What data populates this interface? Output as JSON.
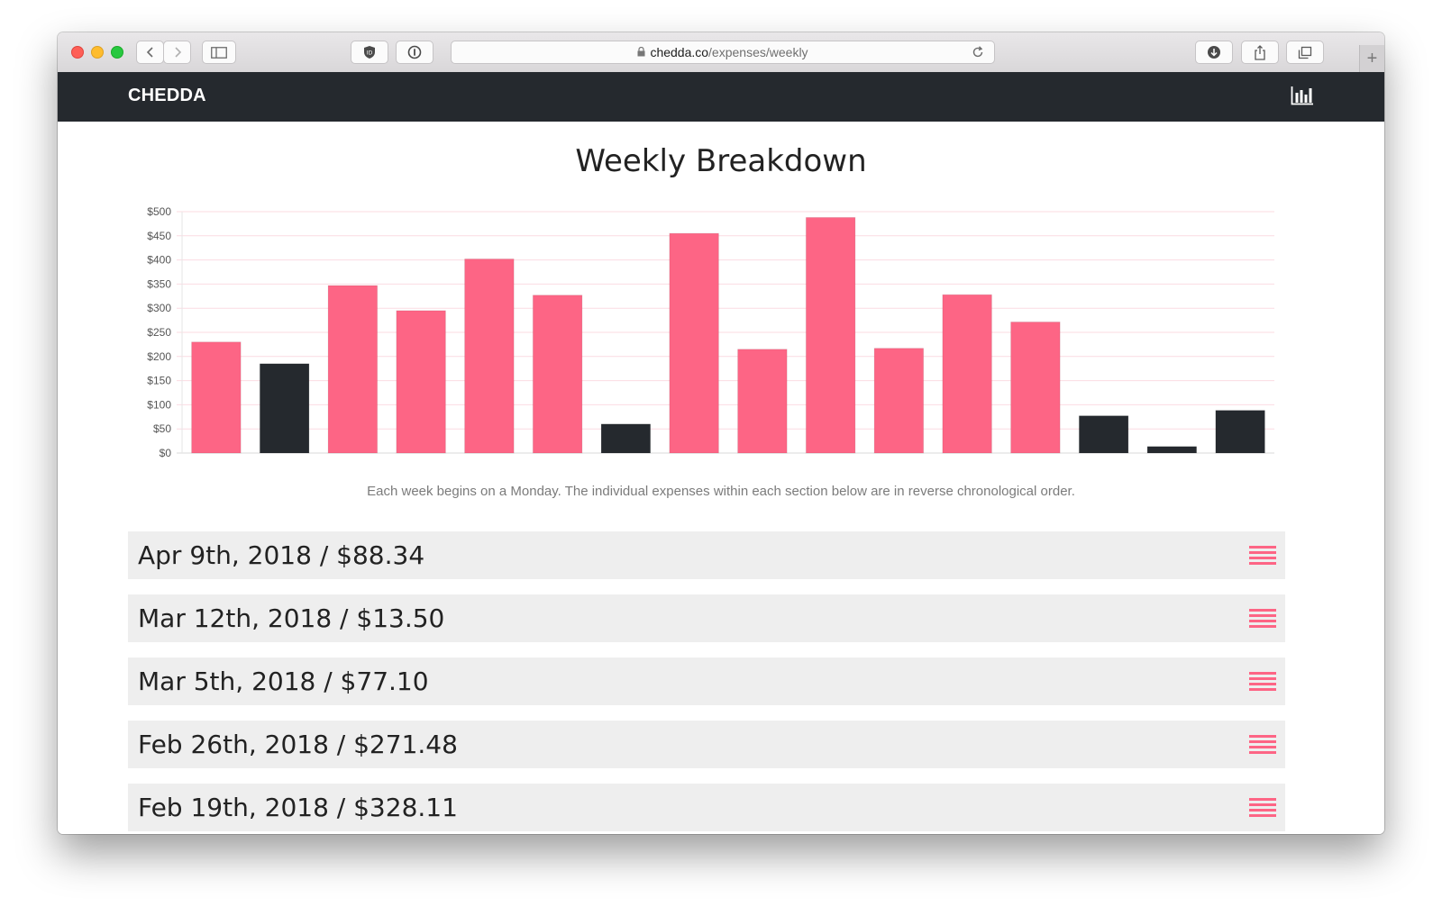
{
  "browser": {
    "url_host": "chedda.co",
    "url_path": "/expenses/weekly"
  },
  "navbar": {
    "brand": "CHEDDA",
    "stats_icon": "bar-chart-icon"
  },
  "page": {
    "title": "Weekly Breakdown",
    "caption": "Each week begins on a Monday. The individual expenses within each section below are in reverse chronological order."
  },
  "colors": {
    "pink": "#fd6585",
    "dark": "#25292e",
    "grid": "#fbdbe2",
    "row_bg": "#eeeeee"
  },
  "chart_data": {
    "type": "bar",
    "title": "",
    "xlabel": "",
    "ylabel": "",
    "ylim": [
      0,
      500
    ],
    "y_ticks": [
      "$0",
      "$50",
      "$100",
      "$150",
      "$200",
      "$250",
      "$300",
      "$350",
      "$400",
      "$450",
      "$500"
    ],
    "grid": true,
    "values": [
      230,
      185,
      347,
      295,
      402,
      327,
      60,
      455,
      215,
      488,
      217,
      328,
      271.48,
      77.1,
      13.5,
      88.34
    ],
    "bar_colors": [
      "#fd6585",
      "#25292e",
      "#fd6585",
      "#fd6585",
      "#fd6585",
      "#fd6585",
      "#25292e",
      "#fd6585",
      "#fd6585",
      "#fd6585",
      "#fd6585",
      "#fd6585",
      "#fd6585",
      "#25292e",
      "#25292e",
      "#25292e"
    ]
  },
  "weeks": [
    {
      "label": "Apr 9th, 2018 / $88.34"
    },
    {
      "label": "Mar 12th, 2018 / $13.50"
    },
    {
      "label": "Mar 5th, 2018 / $77.10"
    },
    {
      "label": "Feb 26th, 2018 / $271.48"
    },
    {
      "label": "Feb 19th, 2018 / $328.11"
    }
  ]
}
